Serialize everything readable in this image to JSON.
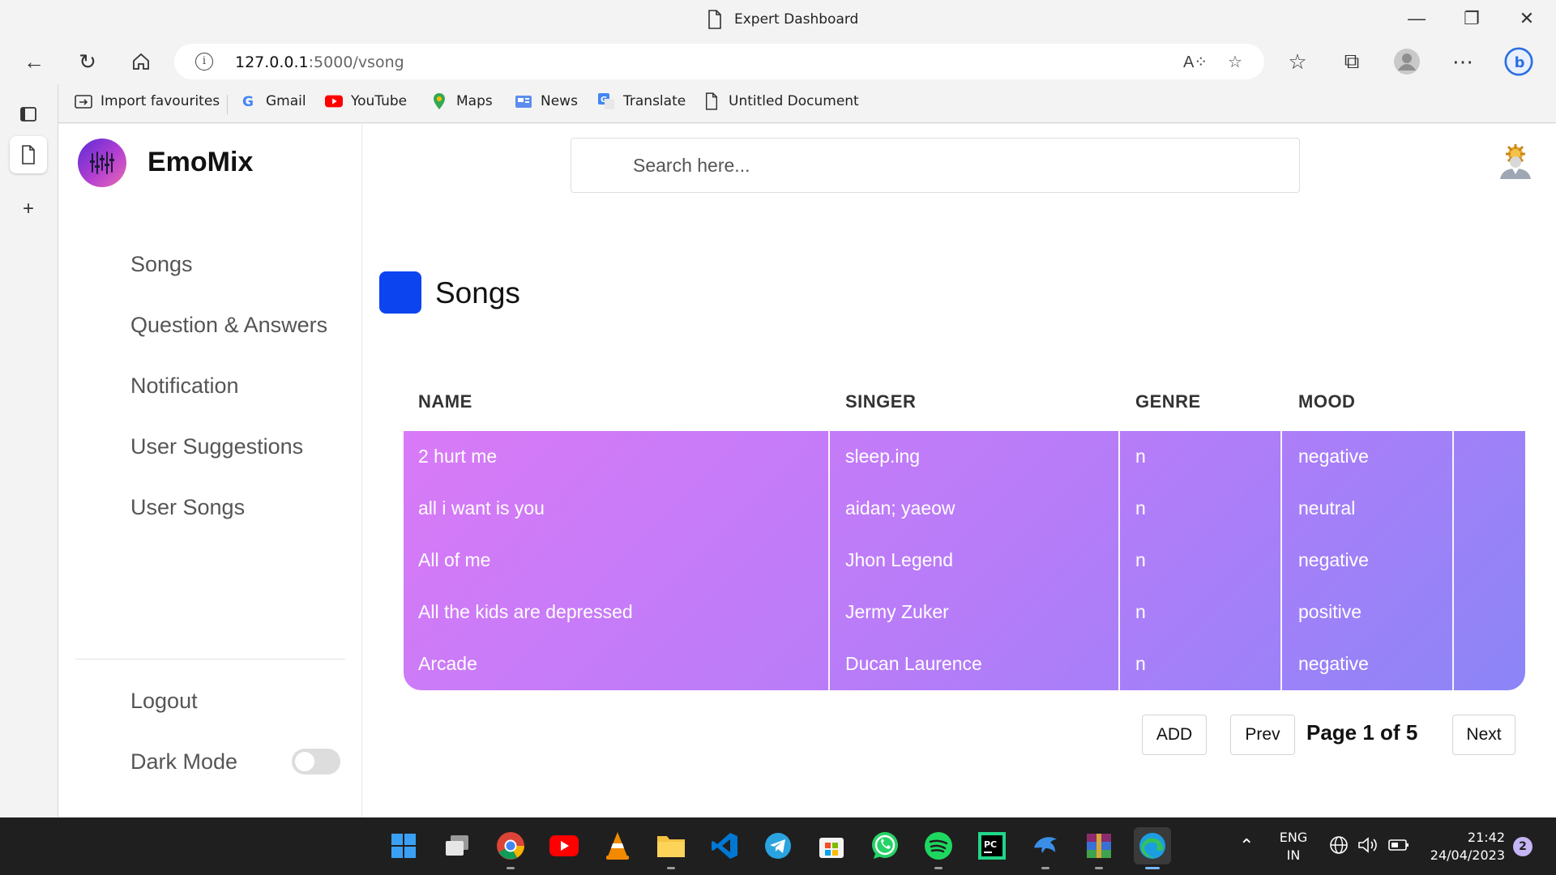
{
  "browser": {
    "window_title": "Expert Dashboard",
    "url_host": "127.0.0.1",
    "url_rest": ":5000/vsong",
    "favourites": [
      {
        "label": "Import favourites",
        "icon": "import-favourites-icon"
      },
      {
        "label": "Gmail",
        "icon": "google-icon"
      },
      {
        "label": "YouTube",
        "icon": "youtube-icon"
      },
      {
        "label": "Maps",
        "icon": "maps-pin-icon"
      },
      {
        "label": "News",
        "icon": "news-icon"
      },
      {
        "label": "Translate",
        "icon": "translate-icon"
      },
      {
        "label": "Untitled Document",
        "icon": "document-icon"
      }
    ]
  },
  "app": {
    "brand": "EmoMix",
    "search_placeholder": "Search here...",
    "menu": [
      "Songs",
      "Question & Answers",
      "Notification",
      "User Suggestions",
      "User Songs"
    ],
    "logout": "Logout",
    "dark_mode": "Dark Mode",
    "dark_mode_on": false,
    "accent_color": "#0c44f0"
  },
  "main": {
    "heading": "Songs",
    "columns": [
      "NAME",
      "SINGER",
      "GENRE",
      "MOOD"
    ],
    "rows": [
      {
        "name": "2 hurt me",
        "singer": "sleep.ing",
        "genre": "n",
        "mood": "negative"
      },
      {
        "name": "all i want is you",
        "singer": "aidan; yaeow",
        "genre": "n",
        "mood": "neutral"
      },
      {
        "name": "All of me",
        "singer": "Jhon Legend",
        "genre": "n",
        "mood": "negative"
      },
      {
        "name": "All the kids are depressed",
        "singer": "Jermy Zuker",
        "genre": "n",
        "mood": "positive"
      },
      {
        "name": "Arcade",
        "singer": "Ducan Laurence",
        "genre": "n",
        "mood": "negative"
      }
    ],
    "add_label": "ADD",
    "prev_label": "Prev",
    "page_indicator": "Page 1 of 5",
    "next_label": "Next"
  },
  "taskbar": {
    "apps": [
      "windows-start-icon",
      "task-view-icon",
      "chrome-icon",
      "youtube-icon",
      "vlc-icon",
      "file-explorer-icon",
      "vscode-icon",
      "telegram-icon",
      "microsoft-store-icon",
      "whatsapp-icon",
      "spotify-icon",
      "pycharm-icon",
      "dolphin-icon",
      "winrar-icon",
      "edge-icon"
    ],
    "lang_line1": "ENG",
    "lang_line2": "IN",
    "time": "21:42",
    "date": "24/04/2023",
    "notification_count": "2"
  }
}
